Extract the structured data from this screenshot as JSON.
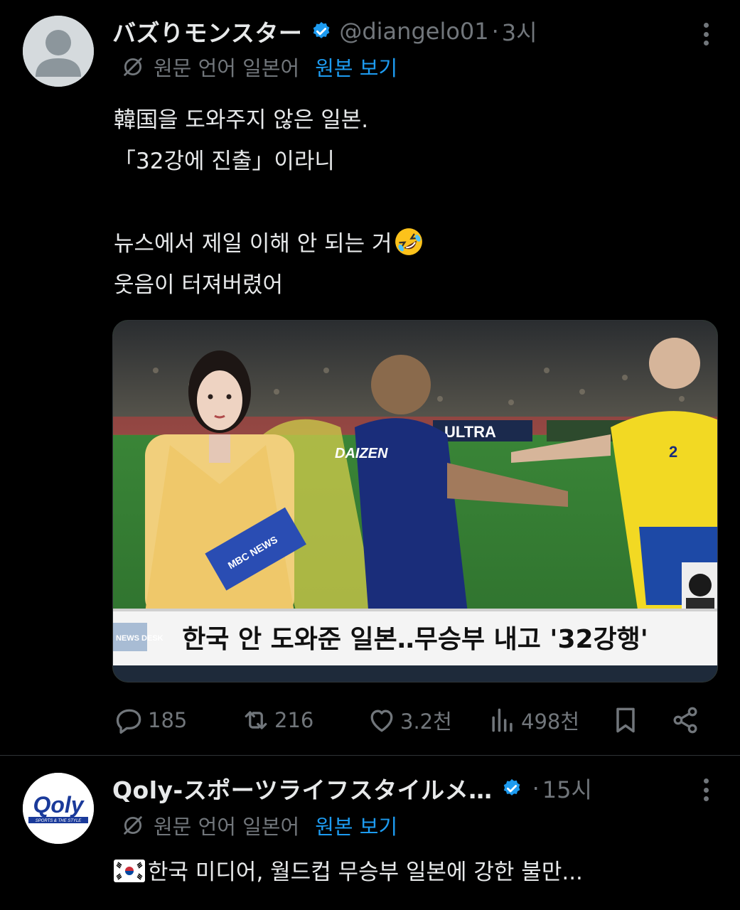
{
  "colors": {
    "background": "#000000",
    "text": "#e7e9ea",
    "muted": "#71767b",
    "link": "#1d9bf0",
    "verified": "#1d9bf0"
  },
  "posts": [
    {
      "display_name": "バズりモンスター",
      "handle": "@diangelo01",
      "separator": "·",
      "time": "3시",
      "translate_label": "원문 언어 일본어",
      "translate_link": "원본 보기",
      "text_lines": [
        "韓国을 도와주지 않은 일본.",
        "「32강에 진출」이라니",
        "",
        "뉴스에서 제일 이해 안 되는 거",
        "웃음이 터져버렸어"
      ],
      "emoji": "rolling-on-the-floor-laughing",
      "media": {
        "caption": "한국 안 도와준 일본‥무승부 내고 '32강행'",
        "caption_side": "NEWS DESK",
        "billboard": "ULTRA",
        "jersey_name": "DAIZEN",
        "jersey_number": "2",
        "folder_text": "MBC NEWS"
      },
      "stats": {
        "replies": "185",
        "reposts": "216",
        "likes": "3.2천",
        "views": "498천"
      },
      "icons": [
        "reply-icon",
        "repost-icon",
        "like-icon",
        "views-icon",
        "bookmark-icon",
        "share-icon"
      ]
    },
    {
      "display_name": "Qoly-スポーツライフスタイルメ…",
      "separator": "·",
      "time": "15시",
      "translate_label": "원문 언어 일본어",
      "translate_link": "원본 보기",
      "avatar_text": "Qoly",
      "avatar_subtext": "SPORTS & THE STYLE",
      "text_flag": "south-korea-flag",
      "text_lines": [
        "한국 미디어, 월드컵 무승부 일본에 강한 불만..."
      ]
    }
  ]
}
